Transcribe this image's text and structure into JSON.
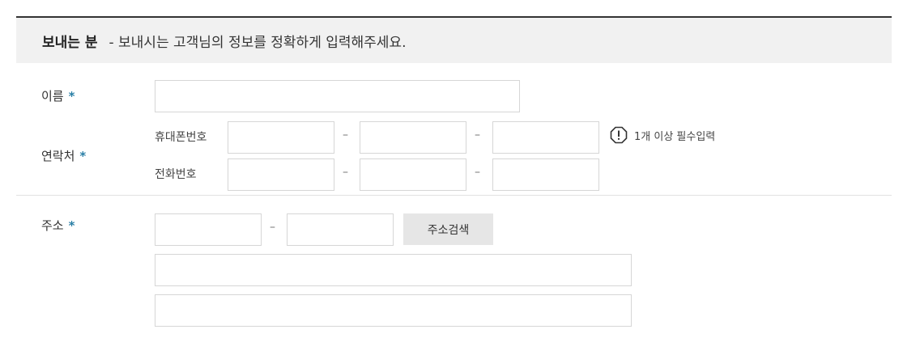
{
  "header": {
    "title": "보내는 분",
    "description": "- 보내시는 고객님의 정보를 정확하게 입력해주세요."
  },
  "fields": {
    "required_mark": "*",
    "name": {
      "label": "이름"
    },
    "contact": {
      "label": "연락처",
      "mobile_label": "휴대폰번호",
      "phone_label": "전화번호",
      "dash": "–",
      "notice": "1개 이상 필수입력"
    },
    "address": {
      "label": "주소",
      "dash": "–",
      "search_button": "주소검색"
    }
  },
  "colors": {
    "accent": "#2a7fa6",
    "header_bg": "#f1f1f1",
    "button_bg": "#e6e6e6"
  },
  "icons": {
    "notice": "exclamation-octagon-icon"
  }
}
